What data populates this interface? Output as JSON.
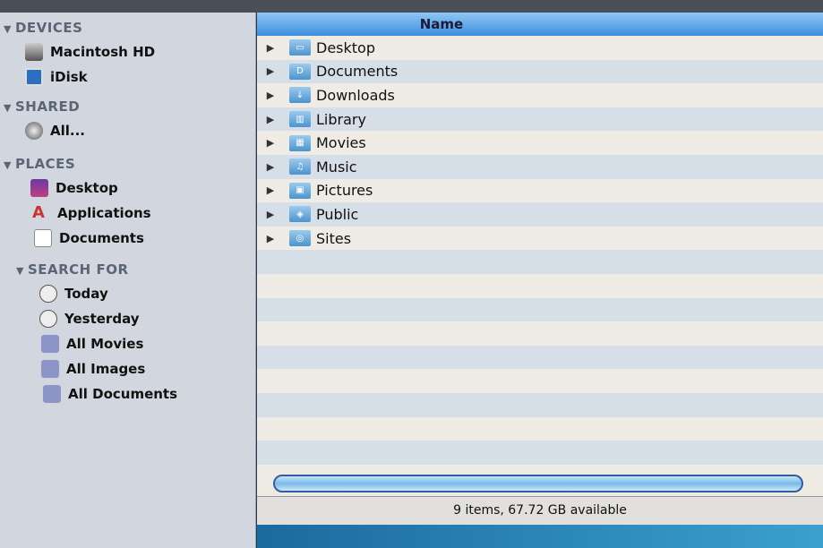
{
  "sidebar": {
    "sections": [
      {
        "title": "DEVICES",
        "items": [
          "Macintosh HD",
          "iDisk"
        ]
      },
      {
        "title": "SHARED",
        "items": [
          "All..."
        ]
      },
      {
        "title": "PLACES",
        "items": [
          "Desktop",
          "Applications",
          "Documents"
        ]
      },
      {
        "title": "SEARCH FOR",
        "items": [
          "Today",
          "Yesterday",
          "All Movies",
          "All Images",
          "All Documents"
        ]
      }
    ]
  },
  "list": {
    "column": "Name",
    "items": [
      "Desktop",
      "Documents",
      "Downloads",
      "Library",
      "Movies",
      "Music",
      "Pictures",
      "Public",
      "Sites"
    ]
  },
  "status": "9 items, 67.72 GB available"
}
